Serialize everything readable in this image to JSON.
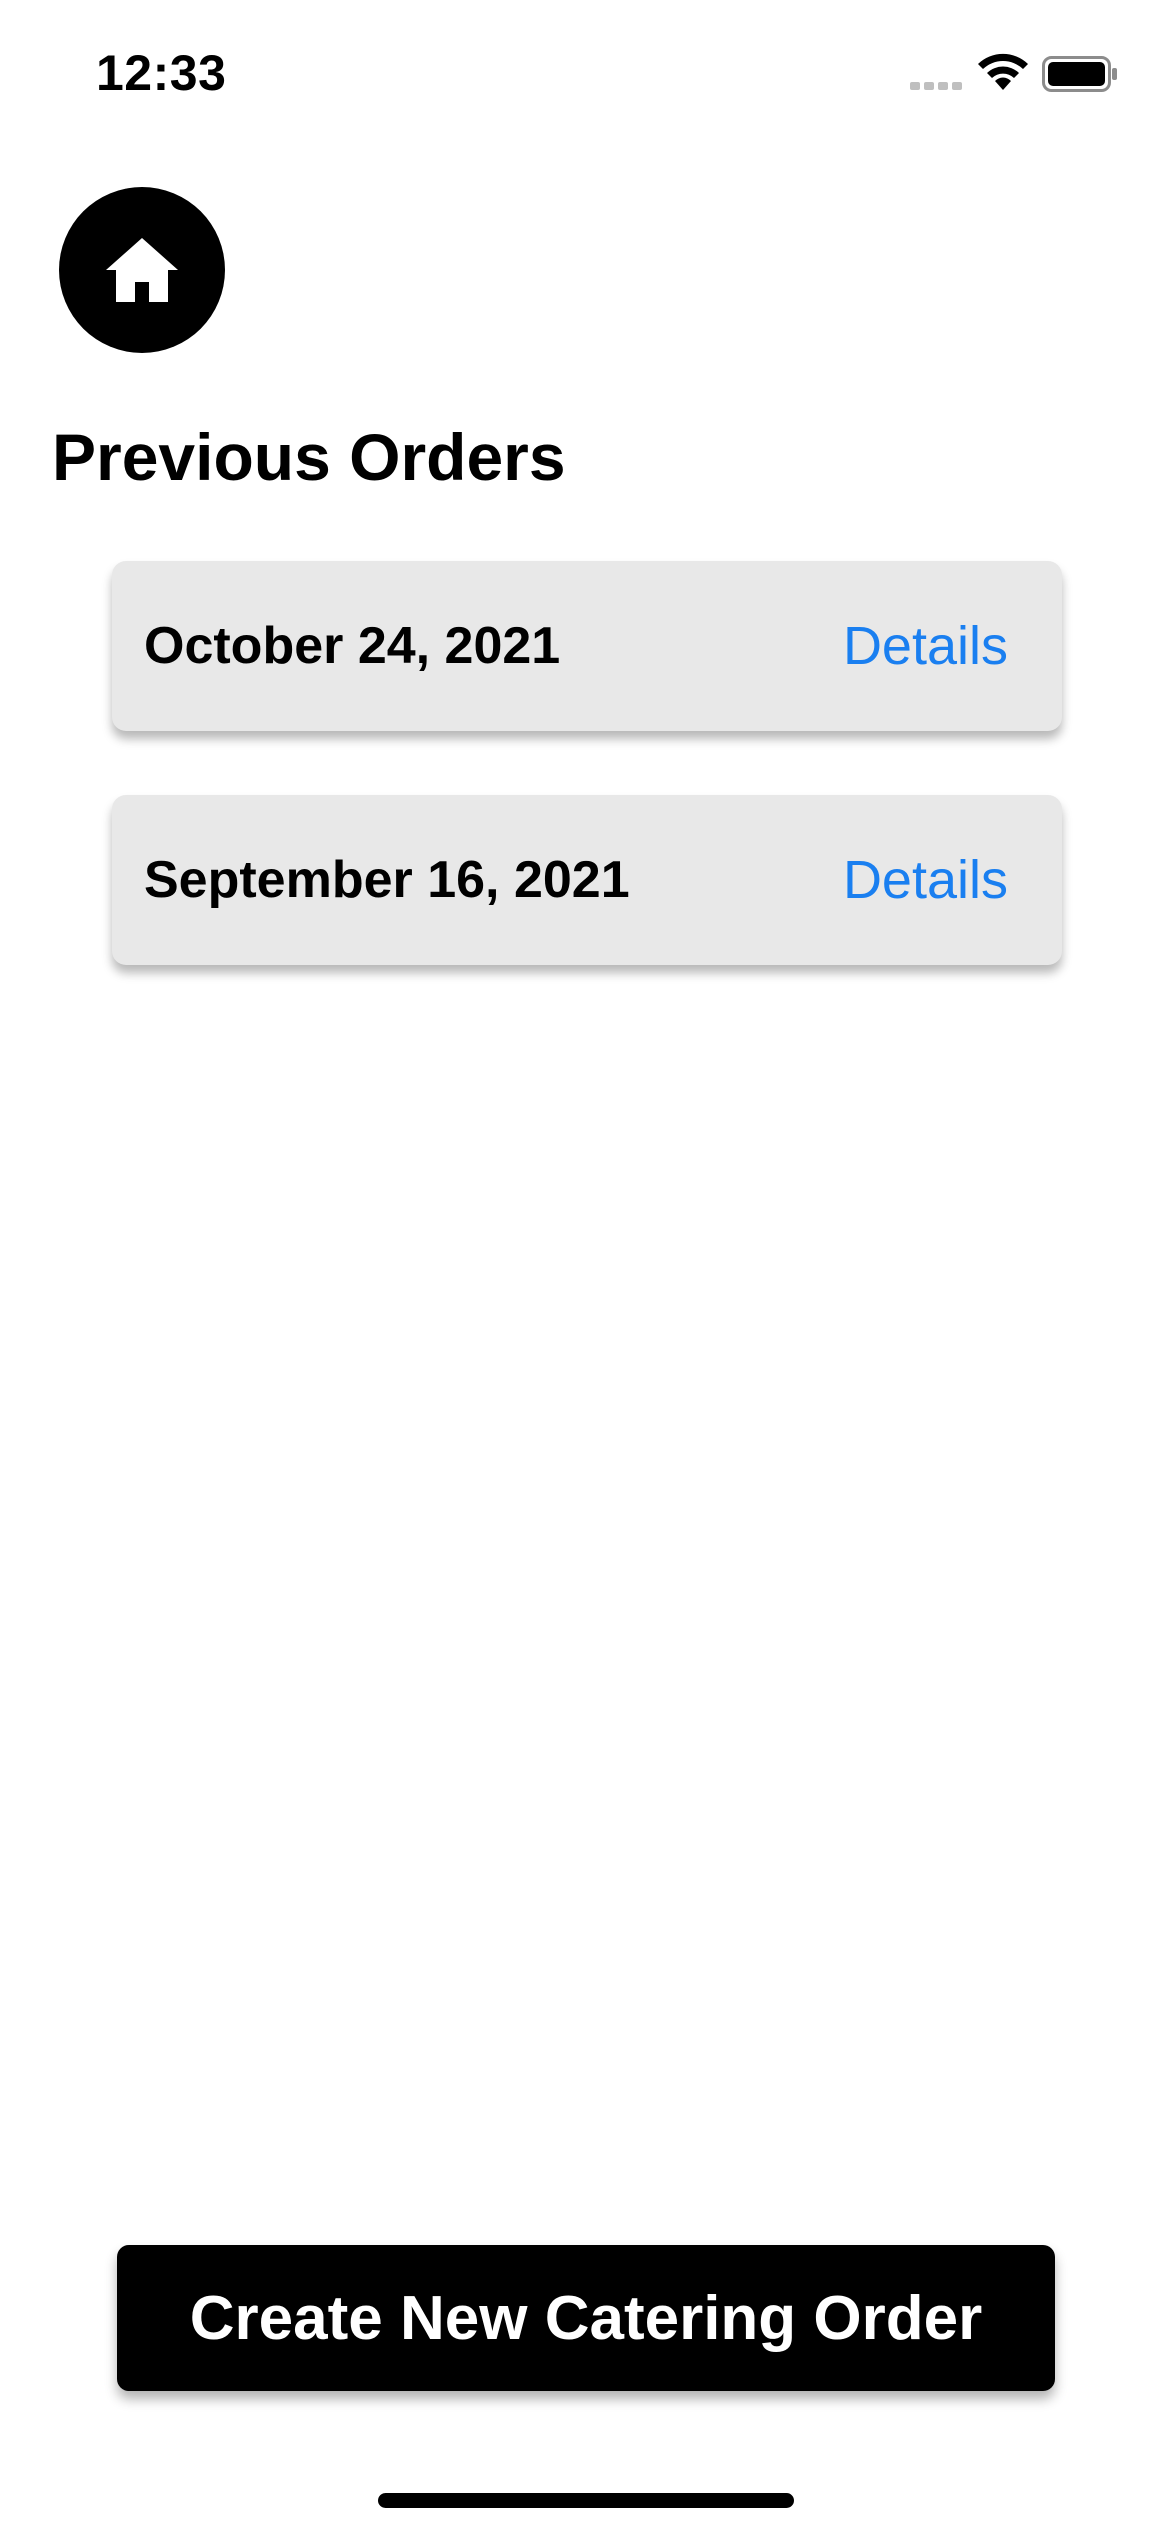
{
  "status_bar": {
    "time": "12:33",
    "signal_icon": "cellular-signal-icon",
    "wifi_icon": "wifi-icon",
    "battery_icon": "battery-icon"
  },
  "header": {
    "home_icon": "home-icon",
    "title": "Previous Orders"
  },
  "orders": [
    {
      "date": "October 24, 2021",
      "action_label": "Details"
    },
    {
      "date": "September 16, 2021",
      "action_label": "Details"
    }
  ],
  "footer": {
    "create_button_label": "Create New Catering Order"
  },
  "colors": {
    "background": "#ffffff",
    "card_background": "#e8e8e8",
    "link": "#1a7ff0",
    "primary_button": "#000000"
  }
}
